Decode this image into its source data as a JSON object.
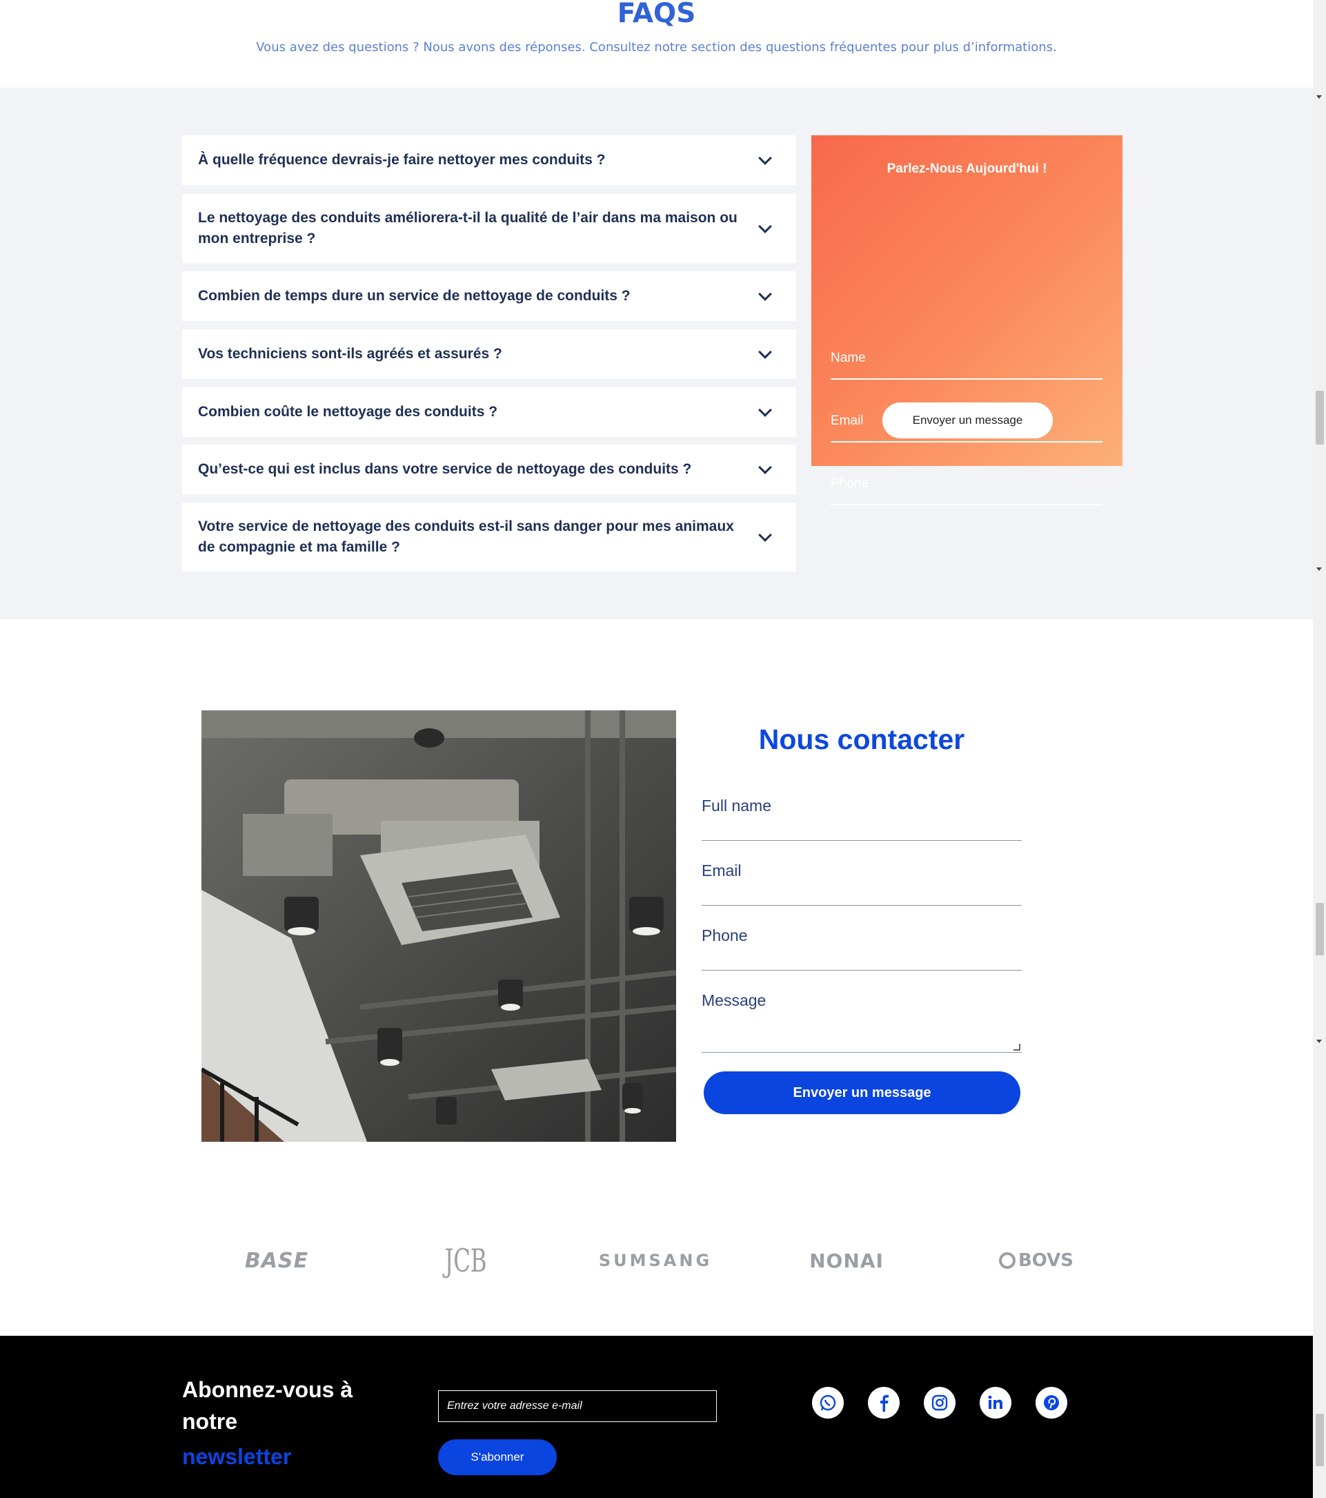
{
  "faq": {
    "title": "FAQS",
    "subtitle": "Vous avez des questions ? Nous avons des réponses. Consultez notre section des questions fréquentes pour plus d’informations.",
    "items": [
      "À quelle fréquence devrais-je faire nettoyer mes conduits ?",
      "Le nettoyage des conduits améliorera-t-il la qualité de l’air dans ma maison ou mon entreprise ?",
      "Combien de temps dure un service de nettoyage de conduits ?",
      "Vos techniciens sont-ils agréés et assurés ?",
      "Combien coûte le nettoyage des conduits ?",
      "Qu’est-ce qui est inclus dans votre service de nettoyage des conduits ?",
      "Votre service de nettoyage des conduits est-il sans danger pour mes animaux de compagnie et ma famille ?"
    ]
  },
  "talk_form": {
    "title": "Parlez-Nous Aujourd'hui !",
    "name": "Name",
    "email": "Email",
    "phone": "Phone",
    "button": "Envoyer un message"
  },
  "contact": {
    "title": "Nous contacter",
    "full_name": "Full name",
    "email": "Email",
    "phone": "Phone",
    "message": "Message",
    "button": "Envoyer un message"
  },
  "logos": [
    "BASE",
    "JCB",
    "SUMSANG",
    "NONAI",
    "BOVS"
  ],
  "newsletter": {
    "line1": "Abonnez-vous à",
    "line2": "notre",
    "line3": "newsletter",
    "placeholder": "Entrez votre adresse e-mail",
    "button": "S'abonner"
  },
  "social_icons": [
    "whatsapp-icon",
    "facebook-icon",
    "instagram-icon",
    "linkedin-icon",
    "pinterest-icon"
  ],
  "colors": {
    "accent_blue": "#0b45e0",
    "faq_title": "#2f63d6",
    "orange_gradient_start": "#f8694a",
    "orange_gradient_end": "#fdb078"
  }
}
